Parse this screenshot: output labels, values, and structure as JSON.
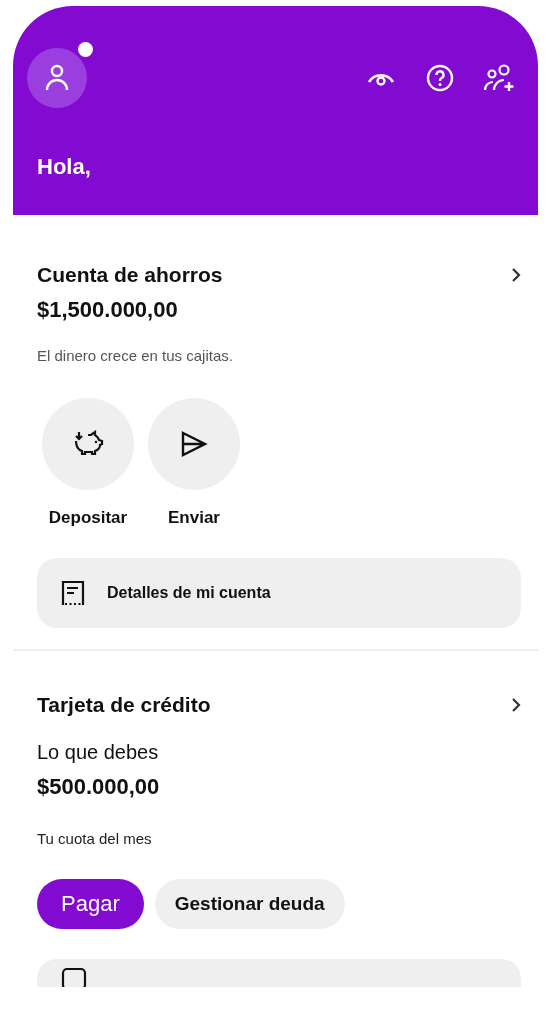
{
  "header": {
    "greeting": "Hola,",
    "notification": true
  },
  "savings": {
    "title": "Cuenta de ahorros",
    "balance": "$1,500.000,00",
    "note": "El dinero crece en tus cajitas.",
    "actions": [
      {
        "label": "Depositar",
        "kind": "deposit"
      },
      {
        "label": "Enviar",
        "kind": "send"
      }
    ],
    "details": "Detalles de mi cuenta"
  },
  "credit": {
    "title": "Tarjeta de crédito",
    "subtitle": "Lo que debes",
    "amount": "$500.000,00",
    "note": "Tu cuota del mes",
    "buttons": [
      {
        "label": "Pagar",
        "kind": "primary"
      },
      {
        "label": "Gestionar deuda",
        "kind": "secondary"
      }
    ]
  }
}
